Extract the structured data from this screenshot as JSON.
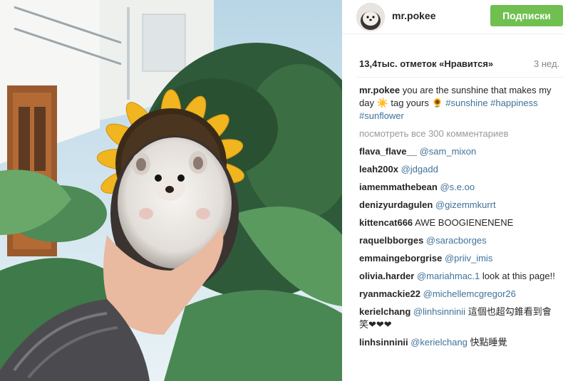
{
  "post": {
    "username": "mr.pokee",
    "follow_label": "Подписки",
    "likes": "13,4тыс. отметок «Нравится»",
    "time_ago": "3 нед.",
    "caption": {
      "user": "mr.pokee",
      "text": "you are the sunshine that makes my day ☀️ tag yours 🌻",
      "tags": "#sunshine #happiness #sunflower"
    },
    "view_all": "посмотреть все 300 комментариев",
    "comments": [
      {
        "user": "flava_flave__",
        "mention": "@sam_mixon",
        "text": ""
      },
      {
        "user": "leah200x",
        "mention": "@jdgadd",
        "text": ""
      },
      {
        "user": "iamemmathebean",
        "mention": "@s.e.oo",
        "text": ""
      },
      {
        "user": "denizyurdagulen",
        "mention": "@gizemmkurrt",
        "text": ""
      },
      {
        "user": "kittencat666",
        "mention": "",
        "text": "AWE BOOGIENENENE"
      },
      {
        "user": "raquelbborges",
        "mention": "@saracborges",
        "text": ""
      },
      {
        "user": "emmaingeborgrise",
        "mention": "@priiv_imis",
        "text": ""
      },
      {
        "user": "olivia.harder",
        "mention": "@mariahmac.1",
        "text": "look at this page!!"
      },
      {
        "user": "ryanmackie22",
        "mention": "@michellemcgregor26",
        "text": ""
      },
      {
        "user": "kerielchang",
        "mention": "@linhsinninii",
        "text": "這個也超勾錐看到會笑❤❤❤"
      },
      {
        "user": "linhsinninii",
        "mention": "@kerielchang",
        "text": "快點睡覺"
      }
    ]
  },
  "icons": {
    "avatar": "hedgehog-avatar"
  },
  "colors": {
    "follow_button": "#70c050",
    "link": "#3f729b",
    "muted": "#999999"
  }
}
